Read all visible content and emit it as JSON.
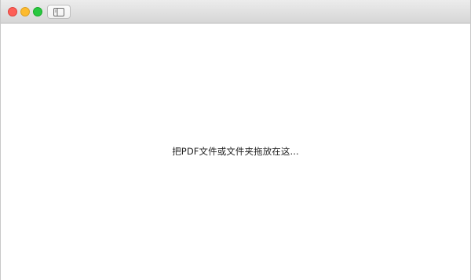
{
  "titlebar": {
    "controls": [
      "close",
      "minimize",
      "zoom"
    ],
    "sidebar_toggle_icon": "sidebar-icon"
  },
  "main": {
    "drop_hint": "把PDF文件或文件夹拖放在这..."
  }
}
